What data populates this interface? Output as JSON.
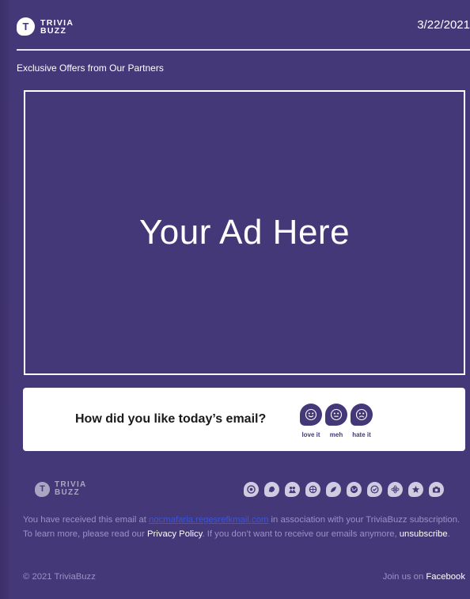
{
  "header": {
    "brand_mark": "T",
    "brand_line1": "TRIVIA",
    "brand_line2": "BUZZ",
    "date": "3/22/2021"
  },
  "partners_label": "Exclusive Offers from Our Partners",
  "ad": {
    "text": "Your Ad Here"
  },
  "feedback": {
    "question": "How did you like today’s email?",
    "reactions": [
      {
        "label": "love it",
        "icon": "smile-icon"
      },
      {
        "label": "meh",
        "icon": "neutral-face-icon"
      },
      {
        "label": "hate it",
        "icon": "frown-icon"
      }
    ]
  },
  "footer": {
    "brand_mark": "T",
    "brand_line1": "TRIVIA",
    "brand_line2": "BUZZ",
    "social_icons": [
      "target-icon",
      "animal-icon",
      "people-icon",
      "globe-pin-icon",
      "bird-icon",
      "world-icon",
      "check-icon",
      "atom-icon",
      "star-icon",
      "camera-icon"
    ],
    "disclaimer": {
      "part1": "You have received this email at ",
      "email": "nocmafaria.regesrefkmail.com",
      "part2": " in association with your TriviaBuzz subscription. To learn more, please read our ",
      "privacy_link": "Privacy Policy",
      "part3": ". If you don’t want to receive our emails anymore, ",
      "unsubscribe_link": "unsubscribe",
      "part4": "."
    },
    "copyright": "© 2021 TriviaBuzz",
    "join_text": "Join us on ",
    "facebook_link": "Facebook"
  },
  "colors": {
    "background": "#443878",
    "text_muted": "#9a92c8",
    "card": "#ffffff",
    "email_link": "#3c55d8"
  }
}
